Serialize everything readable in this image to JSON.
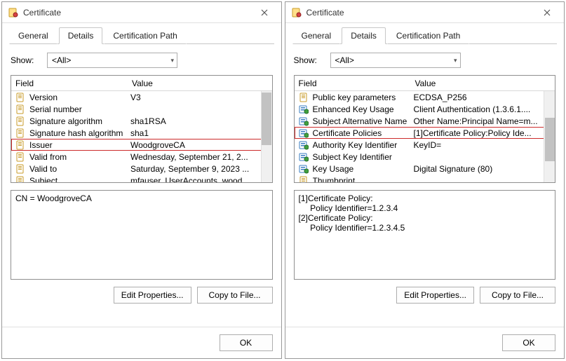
{
  "left": {
    "title": "Certificate",
    "tabs": {
      "general": "General",
      "details": "Details",
      "certpath": "Certification Path"
    },
    "show_label": "Show:",
    "show_value": "<All>",
    "headers": {
      "field": "Field",
      "value": "Value"
    },
    "rows": [
      {
        "icon": "doc",
        "field": "Version",
        "value": "V3"
      },
      {
        "icon": "doc",
        "field": "Serial number",
        "value": ""
      },
      {
        "icon": "doc",
        "field": "Signature algorithm",
        "value": "sha1RSA"
      },
      {
        "icon": "doc",
        "field": "Signature hash algorithm",
        "value": "sha1"
      },
      {
        "icon": "doc",
        "field": "Issuer",
        "value": "WoodgroveCA",
        "highlight": true
      },
      {
        "icon": "doc",
        "field": "Valid from",
        "value": "Wednesday, September 21, 2..."
      },
      {
        "icon": "doc",
        "field": "Valid to",
        "value": "Saturday, September 9, 2023 ..."
      },
      {
        "icon": "doc",
        "field": "Subject",
        "value": "mfauser, UserAccounts, wood..."
      }
    ],
    "detail_text": "CN = WoodgroveCA",
    "buttons": {
      "edit": "Edit Properties...",
      "copy": "Copy to File...",
      "ok": "OK"
    }
  },
  "right": {
    "title": "Certificate",
    "tabs": {
      "general": "General",
      "details": "Details",
      "certpath": "Certification Path"
    },
    "show_label": "Show:",
    "show_value": "<All>",
    "headers": {
      "field": "Field",
      "value": "Value"
    },
    "rows": [
      {
        "icon": "doc",
        "field": "Public key parameters",
        "value": "ECDSA_P256"
      },
      {
        "icon": "ext",
        "field": "Enhanced Key Usage",
        "value": "Client Authentication (1.3.6.1...."
      },
      {
        "icon": "ext",
        "field": "Subject Alternative Name",
        "value": "Other Name:Principal Name=m..."
      },
      {
        "icon": "ext",
        "field": "Certificate Policies",
        "value": "[1]Certificate Policy:Policy Ide...",
        "highlight": true
      },
      {
        "icon": "ext",
        "field": "Authority Key Identifier",
        "value": "KeyID="
      },
      {
        "icon": "ext",
        "field": "Subject Key Identifier",
        "value": ""
      },
      {
        "icon": "ext",
        "field": "Key Usage",
        "value": "Digital Signature (80)"
      },
      {
        "icon": "doc",
        "field": "Thumbprint",
        "value": ""
      }
    ],
    "detail_text": "[1]Certificate Policy:\n     Policy Identifier=1.2.3.4\n[2]Certificate Policy:\n     Policy Identifier=1.2.3.4.5",
    "buttons": {
      "edit": "Edit Properties...",
      "copy": "Copy to File...",
      "ok": "OK"
    }
  }
}
